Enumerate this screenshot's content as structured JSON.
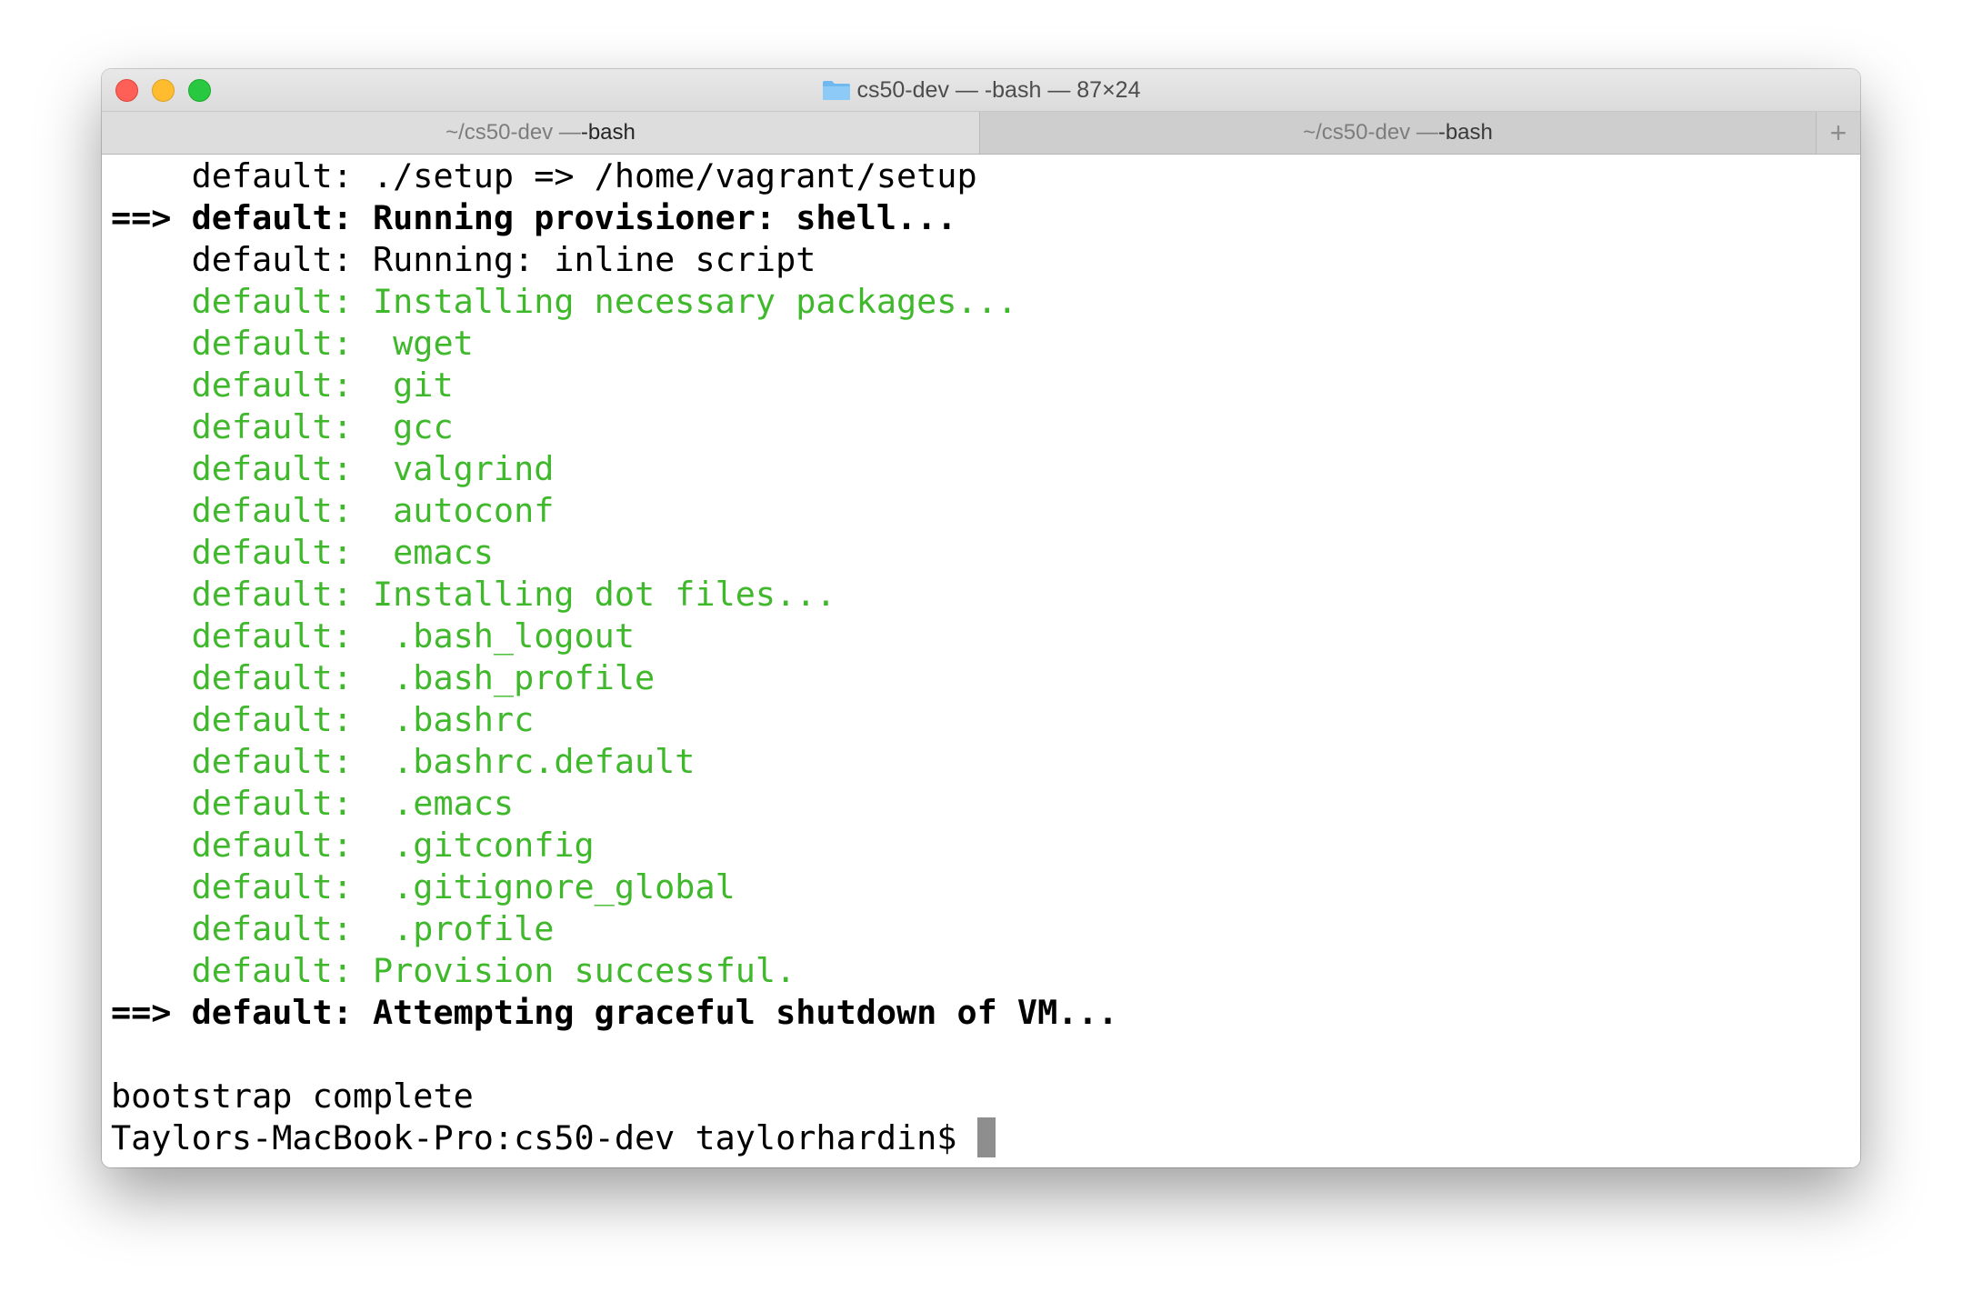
{
  "window": {
    "title": "cs50-dev — -bash — 87×24",
    "title_icon": "folder-icon"
  },
  "tabs": [
    {
      "path": "~/cs50-dev — ",
      "process": "-bash",
      "active": true
    },
    {
      "path": "~/cs50-dev — ",
      "process": "-bash",
      "active": false
    }
  ],
  "new_tab_label": "+",
  "terminal": {
    "lines": [
      {
        "text": "    default: ./setup => /home/vagrant/setup",
        "style": "normal"
      },
      {
        "text": "==> default: Running provisioner: shell...",
        "style": "bold"
      },
      {
        "text": "    default: Running: inline script",
        "style": "normal"
      },
      {
        "text": "    default: Installing necessary packages...",
        "style": "green"
      },
      {
        "text": "    default:  wget",
        "style": "green"
      },
      {
        "text": "    default:  git",
        "style": "green"
      },
      {
        "text": "    default:  gcc",
        "style": "green"
      },
      {
        "text": "    default:  valgrind",
        "style": "green"
      },
      {
        "text": "    default:  autoconf",
        "style": "green"
      },
      {
        "text": "    default:  emacs",
        "style": "green"
      },
      {
        "text": "    default: Installing dot files...",
        "style": "green"
      },
      {
        "text": "    default:  .bash_logout",
        "style": "green"
      },
      {
        "text": "    default:  .bash_profile",
        "style": "green"
      },
      {
        "text": "    default:  .bashrc",
        "style": "green"
      },
      {
        "text": "    default:  .bashrc.default",
        "style": "green"
      },
      {
        "text": "    default:  .emacs",
        "style": "green"
      },
      {
        "text": "    default:  .gitconfig",
        "style": "green"
      },
      {
        "text": "    default:  .gitignore_global",
        "style": "green"
      },
      {
        "text": "    default:  .profile",
        "style": "green"
      },
      {
        "text": "    default: Provision successful.",
        "style": "green"
      },
      {
        "text": "==> default: Attempting graceful shutdown of VM...",
        "style": "bold"
      },
      {
        "text": "",
        "style": "normal"
      },
      {
        "text": "bootstrap complete",
        "style": "normal"
      }
    ],
    "prompt": "Taylors-MacBook-Pro:cs50-dev taylorhardin$ "
  },
  "colors": {
    "green": "#3fb82c",
    "close": "#fe5f57",
    "minimize": "#febc2e",
    "maximize": "#28c840",
    "cursor": "#8e8e8e"
  }
}
